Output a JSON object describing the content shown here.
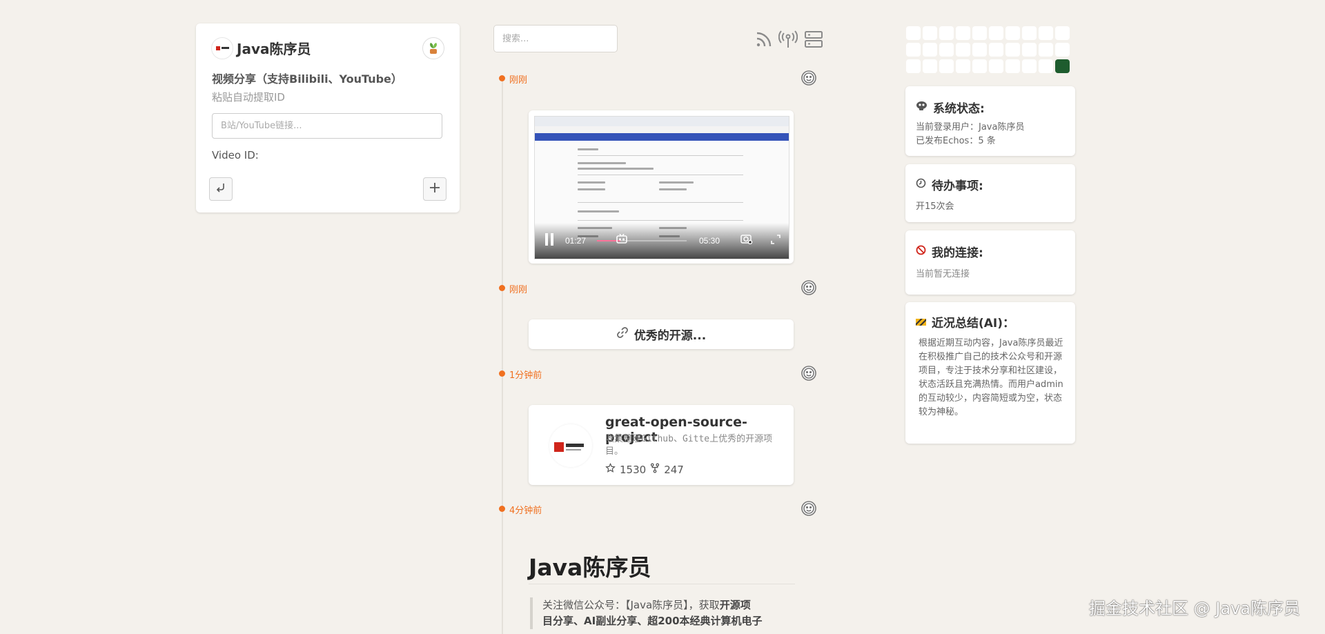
{
  "left_card": {
    "title": "Java陈序员",
    "subtitle": "视频分享（支持Bilibili、YouTube）",
    "hint": "粘贴自动提取ID",
    "link_placeholder": "B站/YouTube链接...",
    "video_id_label": "Video ID:",
    "icons": [
      "avatar",
      "plant-icon",
      "undo-icon",
      "plus-icon"
    ]
  },
  "toolbar": {
    "search_placeholder": "搜索...",
    "icons": [
      "rss-icon",
      "broadcast-icon",
      "server-icon"
    ]
  },
  "timeline": {
    "items": [
      {
        "time": "刚刚",
        "type": "video"
      },
      {
        "time": "刚刚",
        "type": "link"
      },
      {
        "time": "1分钟前",
        "type": "repo"
      },
      {
        "time": "4分钟前",
        "type": "article"
      }
    ],
    "video": {
      "current_time": "01:27",
      "duration": "05:30",
      "progress": 0.264,
      "accent": "#fb7299"
    },
    "link": {
      "label": "优秀的开源..."
    },
    "repo": {
      "name": "great-open-source-project",
      "description": "收集整理Github、Gitte上优秀的开源项目。",
      "stars": "1530",
      "forks": "247"
    },
    "article": {
      "title": "Java陈序员",
      "quote_line1_prefix": "关注微信公众号：【Java陈序员】，获取",
      "quote_line1_strong": "开源项",
      "quote_line2_strong": "目分享、AI副业分享、超200本经典计算机电子"
    },
    "accent": "#f07020"
  },
  "heatmap": {
    "rows": 3,
    "cols": 10,
    "active_color": "#1e5c2e",
    "active_cells": [
      29
    ]
  },
  "sidebar": {
    "status": {
      "title": "系统状态:",
      "line1": "当前登录用户：Java陈序员",
      "line2": "已发布Echos：5 条"
    },
    "todo": {
      "title": "待办事项:",
      "line1": "开15次会"
    },
    "connections": {
      "title": "我的连接:",
      "line1": "当前暂无连接"
    },
    "ai_summary": {
      "title": "近况总结(AI)：",
      "text": "根据近期互动内容，Java陈序员最近在积极推广自己的技术公众号和开源项目，专注于技术分享和社区建设，状态活跃且充满热情。而用户admin的互动较少，内容简短或为空，状态较为神秘。"
    }
  },
  "watermark": "掘金技术社区 @ Java陈序员"
}
